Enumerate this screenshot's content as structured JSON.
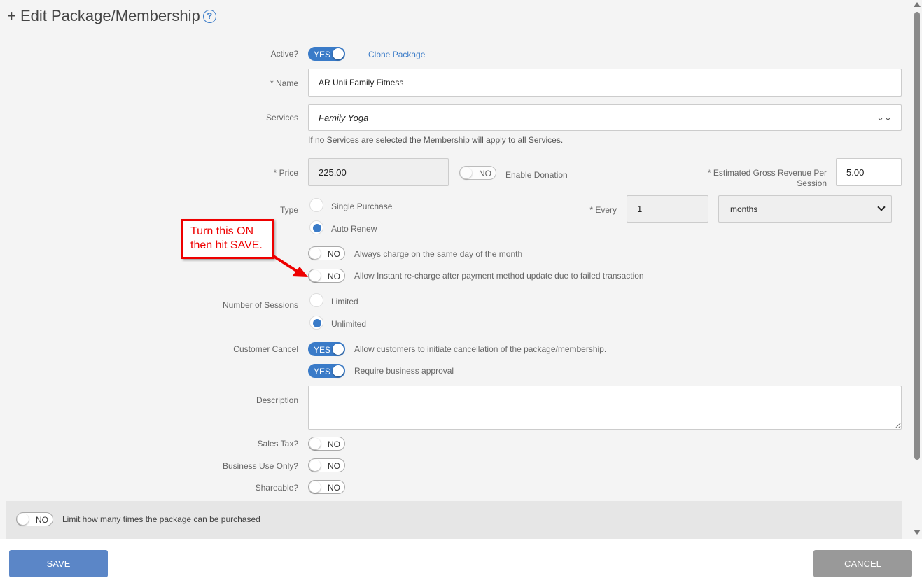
{
  "header": {
    "title": "+ Edit Package/Membership",
    "help_glyph": "?"
  },
  "active": {
    "label": "Active?",
    "toggle": "YES",
    "clone_link": "Clone Package"
  },
  "name": {
    "label": "* Name",
    "value": "AR Unli Family Fitness"
  },
  "services": {
    "label": "Services",
    "value": "Family Yoga",
    "help": "If no Services are selected the Membership will apply to all Services.",
    "expand_glyph": "⌄⌄"
  },
  "price": {
    "label": "* Price",
    "value": "225.00",
    "donation_toggle": "NO",
    "donation_label": "Enable Donation"
  },
  "revenue": {
    "label_line1": "* Estimated Gross Revenue Per",
    "label_line2": "Session",
    "value": "5.00"
  },
  "type": {
    "label": "Type",
    "options": [
      "Single Purchase",
      "Auto Renew"
    ],
    "selected": "Auto Renew",
    "every_label": "* Every",
    "every_value": "1",
    "period": "months"
  },
  "callout": {
    "line1": "Turn this ON",
    "line2": "then hit SAVE.",
    "color": "#e00000"
  },
  "charge_options": [
    {
      "toggle": "NO",
      "label": "Always charge on the same day of the month"
    },
    {
      "toggle": "NO",
      "label": "Allow Instant re-charge after payment method update due to failed transaction"
    }
  ],
  "sessions": {
    "label": "Number of Sessions",
    "options": [
      "Limited",
      "Unlimited"
    ],
    "selected": "Unlimited"
  },
  "customer_cancel": {
    "label": "Customer Cancel",
    "toggle1": "YES",
    "text1": "Allow customers to initiate cancellation of the package/membership.",
    "toggle2": "YES",
    "text2": "Require business approval"
  },
  "description": {
    "label": "Description",
    "value": ""
  },
  "sales_tax": {
    "label": "Sales Tax?",
    "toggle": "NO"
  },
  "business_use": {
    "label": "Business Use Only?",
    "toggle": "NO"
  },
  "shareable": {
    "label": "Shareable?",
    "toggle": "NO"
  },
  "limit": {
    "toggle": "NO",
    "label": "Limit how many times the package can be purchased"
  },
  "footer": {
    "save": "SAVE",
    "cancel": "CANCEL"
  },
  "colors": {
    "accent": "#3a7bc8",
    "save_button": "#5b86c7",
    "cancel_button": "#999999"
  }
}
